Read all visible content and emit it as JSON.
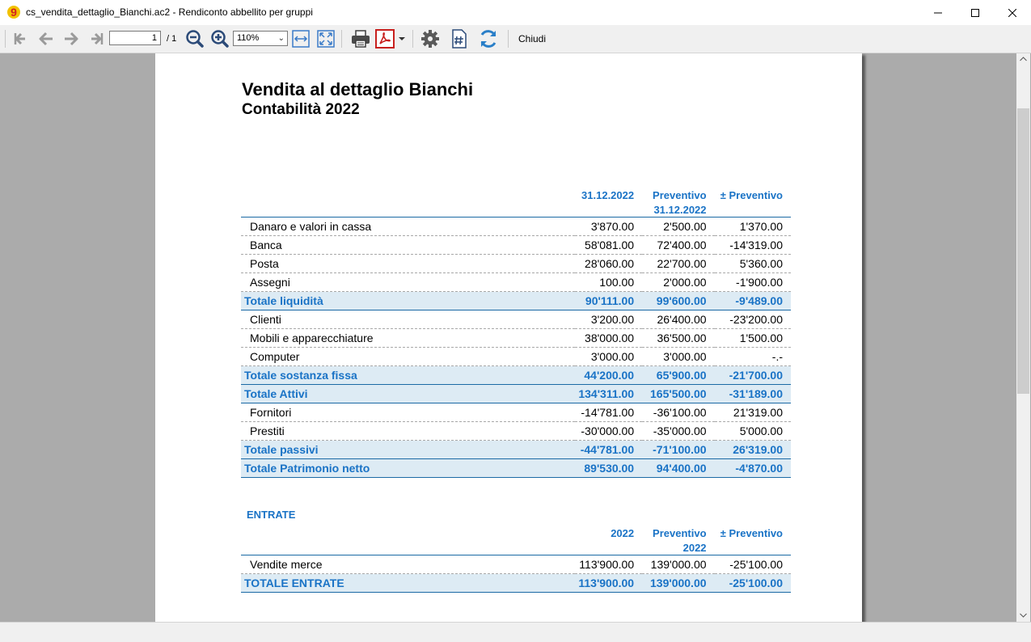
{
  "window": {
    "title": "cs_vendita_dettaglio_Bianchi.ac2 - Rendiconto abbellito per gruppi",
    "app_icon": "banana-app-icon"
  },
  "toolbar": {
    "page_value": "1",
    "page_total": "/ 1",
    "zoom_value": "110%",
    "close_label": "Chiudi"
  },
  "report": {
    "title": "Vendita al dettaglio Bianchi",
    "subtitle": "Contabilità 2022",
    "balance": {
      "headers": [
        {
          "col1": "",
          "col2": "31.12.2022",
          "col3": "Preventivo",
          "col4": "± Preventivo"
        },
        {
          "col1": "",
          "col2": "",
          "col3": "31.12.2022",
          "col4": ""
        }
      ],
      "rows": [
        {
          "type": "item",
          "label": "Danaro e valori in cassa",
          "v1": "3'870.00",
          "v2": "2'500.00",
          "v3": "1'370.00"
        },
        {
          "type": "item",
          "label": "Banca",
          "v1": "58'081.00",
          "v2": "72'400.00",
          "v3": "-14'319.00"
        },
        {
          "type": "item",
          "label": "Posta",
          "v1": "28'060.00",
          "v2": "22'700.00",
          "v3": "5'360.00"
        },
        {
          "type": "item",
          "label": "Assegni",
          "v1": "100.00",
          "v2": "2'000.00",
          "v3": "-1'900.00"
        },
        {
          "type": "total",
          "label": "Totale liquidità",
          "v1": "90'111.00",
          "v2": "99'600.00",
          "v3": "-9'489.00"
        },
        {
          "type": "item",
          "label": "Clienti",
          "v1": "3'200.00",
          "v2": "26'400.00",
          "v3": "-23'200.00"
        },
        {
          "type": "item",
          "label": "Mobili e apparecchiature",
          "v1": "38'000.00",
          "v2": "36'500.00",
          "v3": "1'500.00"
        },
        {
          "type": "item",
          "label": "Computer",
          "v1": "3'000.00",
          "v2": "3'000.00",
          "v3": "-.-"
        },
        {
          "type": "total",
          "label": "Totale sostanza fissa",
          "v1": "44'200.00",
          "v2": "65'900.00",
          "v3": "-21'700.00"
        },
        {
          "type": "total2",
          "label": "Totale Attivi",
          "v1": "134'311.00",
          "v2": "165'500.00",
          "v3": "-31'189.00"
        },
        {
          "type": "item",
          "label": "Fornitori",
          "v1": "-14'781.00",
          "v2": "-36'100.00",
          "v3": "21'319.00"
        },
        {
          "type": "item",
          "label": "Prestiti",
          "v1": "-30'000.00",
          "v2": "-35'000.00",
          "v3": "5'000.00"
        },
        {
          "type": "total",
          "label": "Totale passivi",
          "v1": "-44'781.00",
          "v2": "-71'100.00",
          "v3": "26'319.00"
        },
        {
          "type": "total",
          "label": "Totale Patrimonio netto",
          "v1": "89'530.00",
          "v2": "94'400.00",
          "v3": "-4'870.00"
        }
      ]
    },
    "income": {
      "section_label": "ENTRATE",
      "headers": [
        {
          "col1": "",
          "col2": "2022",
          "col3": "Preventivo",
          "col4": "± Preventivo"
        },
        {
          "col1": "",
          "col2": "",
          "col3": "2022",
          "col4": ""
        }
      ],
      "rows": [
        {
          "type": "item",
          "label": "Vendite merce",
          "v1": "113'900.00",
          "v2": "139'000.00",
          "v3": "-25'100.00"
        },
        {
          "type": "total",
          "label": "TOTALE ENTRATE",
          "v1": "113'900.00",
          "v2": "139'000.00",
          "v3": "-25'100.00"
        }
      ]
    }
  }
}
